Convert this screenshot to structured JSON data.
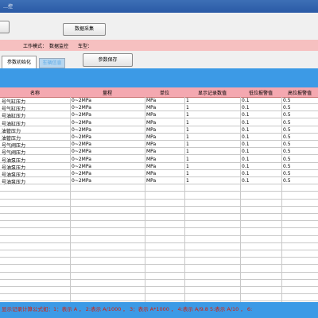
{
  "window": {
    "title": "…控"
  },
  "toolbar": {
    "data_collect_label": "数据采集"
  },
  "status": {
    "work_mode_label": "工作模式：",
    "work_mode_value": "数据监控",
    "model_label": "车型："
  },
  "tabs": [
    {
      "label": "参数初始化",
      "active": true
    },
    {
      "label": "车辆信息",
      "active": false
    }
  ],
  "save_button_label": "参数保存",
  "table": {
    "columns": [
      "名称",
      "量程",
      "单位",
      "显示记录数值",
      "低位报警值",
      "高位报警值"
    ],
    "rows": [
      [
        "号气缸压力",
        "0~2MPa",
        "MPa",
        "1",
        "0.1",
        "0.5"
      ],
      [
        "号气缸压力",
        "0~2MPa",
        "MPa",
        "1",
        "0.1",
        "0.5"
      ],
      [
        "号油缸压力",
        "0~2MPa",
        "MPa",
        "1",
        "0.1",
        "0.5"
      ],
      [
        "号油缸压力",
        "0~2MPa",
        "MPa",
        "1",
        "0.1",
        "0.5"
      ],
      [
        "油管压力",
        "0~2MPa",
        "MPa",
        "1",
        "0.1",
        "0.5"
      ],
      [
        "油管压力",
        "0~2MPa",
        "MPa",
        "1",
        "0.1",
        "0.5"
      ],
      [
        "号气阀压力",
        "0~2MPa",
        "MPa",
        "1",
        "0.1",
        "0.5"
      ],
      [
        "号气阀压力",
        "0~2MPa",
        "MPa",
        "1",
        "0.1",
        "0.5"
      ],
      [
        "号油泵压力",
        "0~2MPa",
        "MPa",
        "1",
        "0.1",
        "0.5"
      ],
      [
        "号油泵压力",
        "0~2MPa",
        "MPa",
        "1",
        "0.1",
        "0.5"
      ],
      [
        "号油泵压力",
        "0~2MPa",
        "MPa",
        "1",
        "0.1",
        "0.5"
      ],
      [
        "号油泵压力",
        "0~2MPa",
        "MPa",
        "1",
        "0.1",
        "0.5"
      ]
    ]
  },
  "footer_text": "显示记录计算公式如：1：表示 A ， 2:表示 A/1000 ， 3：表示 A*1000 ， 4:表示 A/9.8 5:表示 A/10 ， 6:"
}
